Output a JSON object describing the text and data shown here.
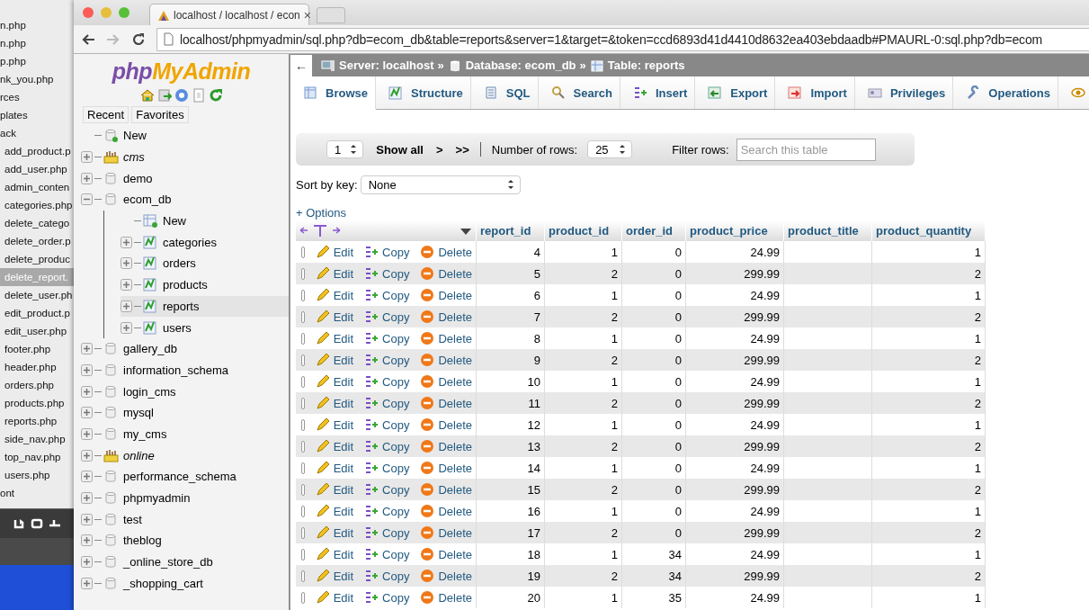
{
  "desktop": {
    "files": [
      {
        "name": "n.php",
        "selected": false
      },
      {
        "name": "n.php",
        "selected": false
      },
      {
        "name": "p.php",
        "selected": false
      },
      {
        "name": "nk_you.php",
        "selected": false
      },
      {
        "name": "rces",
        "selected": false
      },
      {
        "name": "plates",
        "selected": false
      },
      {
        "name": "ack",
        "selected": false
      },
      {
        "name": "add_product.p",
        "selected": false
      },
      {
        "name": "add_user.php",
        "selected": false
      },
      {
        "name": "admin_conten",
        "selected": false
      },
      {
        "name": "categories.php",
        "selected": false
      },
      {
        "name": "delete_catego",
        "selected": false
      },
      {
        "name": "delete_order.p",
        "selected": false
      },
      {
        "name": "delete_produc",
        "selected": false
      },
      {
        "name": "delete_report.",
        "selected": true
      },
      {
        "name": "delete_user.ph",
        "selected": false
      },
      {
        "name": "edit_product.p",
        "selected": false
      },
      {
        "name": "edit_user.php",
        "selected": false
      },
      {
        "name": "footer.php",
        "selected": false
      },
      {
        "name": "header.php",
        "selected": false
      },
      {
        "name": "orders.php",
        "selected": false
      },
      {
        "name": "products.php",
        "selected": false
      },
      {
        "name": "reports.php",
        "selected": false
      },
      {
        "name": "side_nav.php",
        "selected": false
      },
      {
        "name": "top_nav.php",
        "selected": false
      },
      {
        "name": "users.php",
        "selected": false
      },
      {
        "name": "ont",
        "selected": false
      }
    ]
  },
  "browser": {
    "tab_title": "localhost / localhost / econ",
    "close": "×",
    "url": "localhost/phpmyadmin/sql.php?db=ecom_db&table=reports&server=1&target=&token=ccd6893d41d4410d8632ea403ebdaadb#PMAURL-0:sql.php?db=ecom"
  },
  "sidebar": {
    "logo": {
      "prefix": "php",
      "name": "MyAdmin"
    },
    "tabs": [
      {
        "label": "Recent",
        "selected": false
      },
      {
        "label": "Favorites",
        "selected": false
      }
    ],
    "tree": [
      {
        "label": "New",
        "kind": "new",
        "selected": false
      },
      {
        "label": "cms",
        "kind": "group",
        "expanded": false,
        "selected": false
      },
      {
        "label": "demo",
        "kind": "db",
        "expanded": false,
        "selected": false
      },
      {
        "label": "ecom_db",
        "kind": "db",
        "expanded": true,
        "selected": false,
        "children": [
          {
            "label": "New",
            "kind": "new_table",
            "selected": false
          },
          {
            "label": "categories",
            "kind": "table",
            "expanded": false,
            "selected": false
          },
          {
            "label": "orders",
            "kind": "table",
            "expanded": false,
            "selected": false
          },
          {
            "label": "products",
            "kind": "table",
            "expanded": false,
            "selected": false
          },
          {
            "label": "reports",
            "kind": "table",
            "expanded": false,
            "selected": true
          },
          {
            "label": "users",
            "kind": "table",
            "expanded": false,
            "selected": false
          }
        ]
      },
      {
        "label": "gallery_db",
        "kind": "db",
        "expanded": false,
        "selected": false
      },
      {
        "label": "information_schema",
        "kind": "db",
        "expanded": false,
        "selected": false
      },
      {
        "label": "login_cms",
        "kind": "db",
        "expanded": false,
        "selected": false
      },
      {
        "label": "mysql",
        "kind": "db",
        "expanded": false,
        "selected": false
      },
      {
        "label": "my_cms",
        "kind": "db",
        "expanded": false,
        "selected": false
      },
      {
        "label": "online",
        "kind": "group",
        "expanded": false,
        "selected": false
      },
      {
        "label": "performance_schema",
        "kind": "db",
        "expanded": false,
        "selected": false
      },
      {
        "label": "phpmyadmin",
        "kind": "db",
        "expanded": false,
        "selected": false
      },
      {
        "label": "test",
        "kind": "db",
        "expanded": false,
        "selected": false
      },
      {
        "label": "theblog",
        "kind": "db",
        "expanded": false,
        "selected": false
      },
      {
        "label": "_online_store_db",
        "kind": "db",
        "expanded": false,
        "selected": false
      },
      {
        "label": "_shopping_cart",
        "kind": "db",
        "expanded": false,
        "selected": false
      }
    ]
  },
  "breadcrumb": {
    "back": "←",
    "separator": "»",
    "items": [
      {
        "kind": "server",
        "label": "Server: localhost"
      },
      {
        "kind": "database",
        "label": "Database: ecom_db"
      },
      {
        "kind": "table",
        "label": "Table: reports"
      }
    ]
  },
  "tabs": [
    {
      "kind": "browse",
      "label": "Browse",
      "selected": true
    },
    {
      "kind": "structure",
      "label": "Structure",
      "selected": false
    },
    {
      "kind": "sql",
      "label": "SQL",
      "selected": false
    },
    {
      "kind": "search",
      "label": "Search",
      "selected": false
    },
    {
      "kind": "insert",
      "label": "Insert",
      "selected": false
    },
    {
      "kind": "export",
      "label": "Export",
      "selected": false
    },
    {
      "kind": "import",
      "label": "Import",
      "selected": false
    },
    {
      "kind": "privileges",
      "label": "Privileges",
      "selected": false
    },
    {
      "kind": "operations",
      "label": "Operations",
      "selected": false
    },
    {
      "kind": "tracking",
      "selected": false
    }
  ],
  "navigation": {
    "page": "1",
    "show_all": "Show all",
    "next": ">",
    "last": ">>",
    "rows_label": "Number of rows:",
    "rows": "25",
    "filter_label": "Filter rows:",
    "filter_placeholder": "Search this table"
  },
  "sort": {
    "label": "Sort by key:",
    "value": "None"
  },
  "options": "+ Options",
  "table": {
    "columns": [
      "report_id",
      "product_id",
      "order_id",
      "product_price",
      "product_title",
      "product_quantity"
    ],
    "rows": [
      {
        "checked": false,
        "edit": "Edit",
        "copy": "Copy",
        "delete": "Delete",
        "report_id": "4",
        "product_id": "1",
        "order_id": "0",
        "product_price": "24.99",
        "product_quantity": "1"
      },
      {
        "checked": false,
        "edit": "Edit",
        "copy": "Copy",
        "delete": "Delete",
        "report_id": "5",
        "product_id": "2",
        "order_id": "0",
        "product_price": "299.99",
        "product_quantity": "2"
      },
      {
        "checked": false,
        "edit": "Edit",
        "copy": "Copy",
        "delete": "Delete",
        "report_id": "6",
        "product_id": "1",
        "order_id": "0",
        "product_price": "24.99",
        "product_quantity": "1"
      },
      {
        "checked": false,
        "edit": "Edit",
        "copy": "Copy",
        "delete": "Delete",
        "report_id": "7",
        "product_id": "2",
        "order_id": "0",
        "product_price": "299.99",
        "product_quantity": "2"
      },
      {
        "checked": false,
        "edit": "Edit",
        "copy": "Copy",
        "delete": "Delete",
        "report_id": "8",
        "product_id": "1",
        "order_id": "0",
        "product_price": "24.99",
        "product_quantity": "1"
      },
      {
        "checked": false,
        "edit": "Edit",
        "copy": "Copy",
        "delete": "Delete",
        "report_id": "9",
        "product_id": "2",
        "order_id": "0",
        "product_price": "299.99",
        "product_quantity": "2"
      },
      {
        "checked": false,
        "edit": "Edit",
        "copy": "Copy",
        "delete": "Delete",
        "report_id": "10",
        "product_id": "1",
        "order_id": "0",
        "product_price": "24.99",
        "product_quantity": "1"
      },
      {
        "checked": false,
        "edit": "Edit",
        "copy": "Copy",
        "delete": "Delete",
        "report_id": "11",
        "product_id": "2",
        "order_id": "0",
        "product_price": "299.99",
        "product_quantity": "2"
      },
      {
        "checked": false,
        "edit": "Edit",
        "copy": "Copy",
        "delete": "Delete",
        "report_id": "12",
        "product_id": "1",
        "order_id": "0",
        "product_price": "24.99",
        "product_quantity": "1"
      },
      {
        "checked": false,
        "edit": "Edit",
        "copy": "Copy",
        "delete": "Delete",
        "report_id": "13",
        "product_id": "2",
        "order_id": "0",
        "product_price": "299.99",
        "product_quantity": "2"
      },
      {
        "checked": false,
        "edit": "Edit",
        "copy": "Copy",
        "delete": "Delete",
        "report_id": "14",
        "product_id": "1",
        "order_id": "0",
        "product_price": "24.99",
        "product_quantity": "1"
      },
      {
        "checked": false,
        "edit": "Edit",
        "copy": "Copy",
        "delete": "Delete",
        "report_id": "15",
        "product_id": "2",
        "order_id": "0",
        "product_price": "299.99",
        "product_quantity": "2"
      },
      {
        "checked": false,
        "edit": "Edit",
        "copy": "Copy",
        "delete": "Delete",
        "report_id": "16",
        "product_id": "1",
        "order_id": "0",
        "product_price": "24.99",
        "product_quantity": "1"
      },
      {
        "checked": false,
        "edit": "Edit",
        "copy": "Copy",
        "delete": "Delete",
        "report_id": "17",
        "product_id": "2",
        "order_id": "0",
        "product_price": "299.99",
        "product_quantity": "2"
      },
      {
        "checked": false,
        "edit": "Edit",
        "copy": "Copy",
        "delete": "Delete",
        "report_id": "18",
        "product_id": "1",
        "order_id": "34",
        "product_price": "24.99",
        "product_quantity": "1"
      },
      {
        "checked": false,
        "edit": "Edit",
        "copy": "Copy",
        "delete": "Delete",
        "report_id": "19",
        "product_id": "2",
        "order_id": "34",
        "product_price": "299.99",
        "product_quantity": "2"
      },
      {
        "checked": false,
        "edit": "Edit",
        "copy": "Copy",
        "delete": "Delete",
        "report_id": "20",
        "product_id": "1",
        "order_id": "35",
        "product_price": "24.99",
        "product_quantity": "1"
      }
    ]
  }
}
